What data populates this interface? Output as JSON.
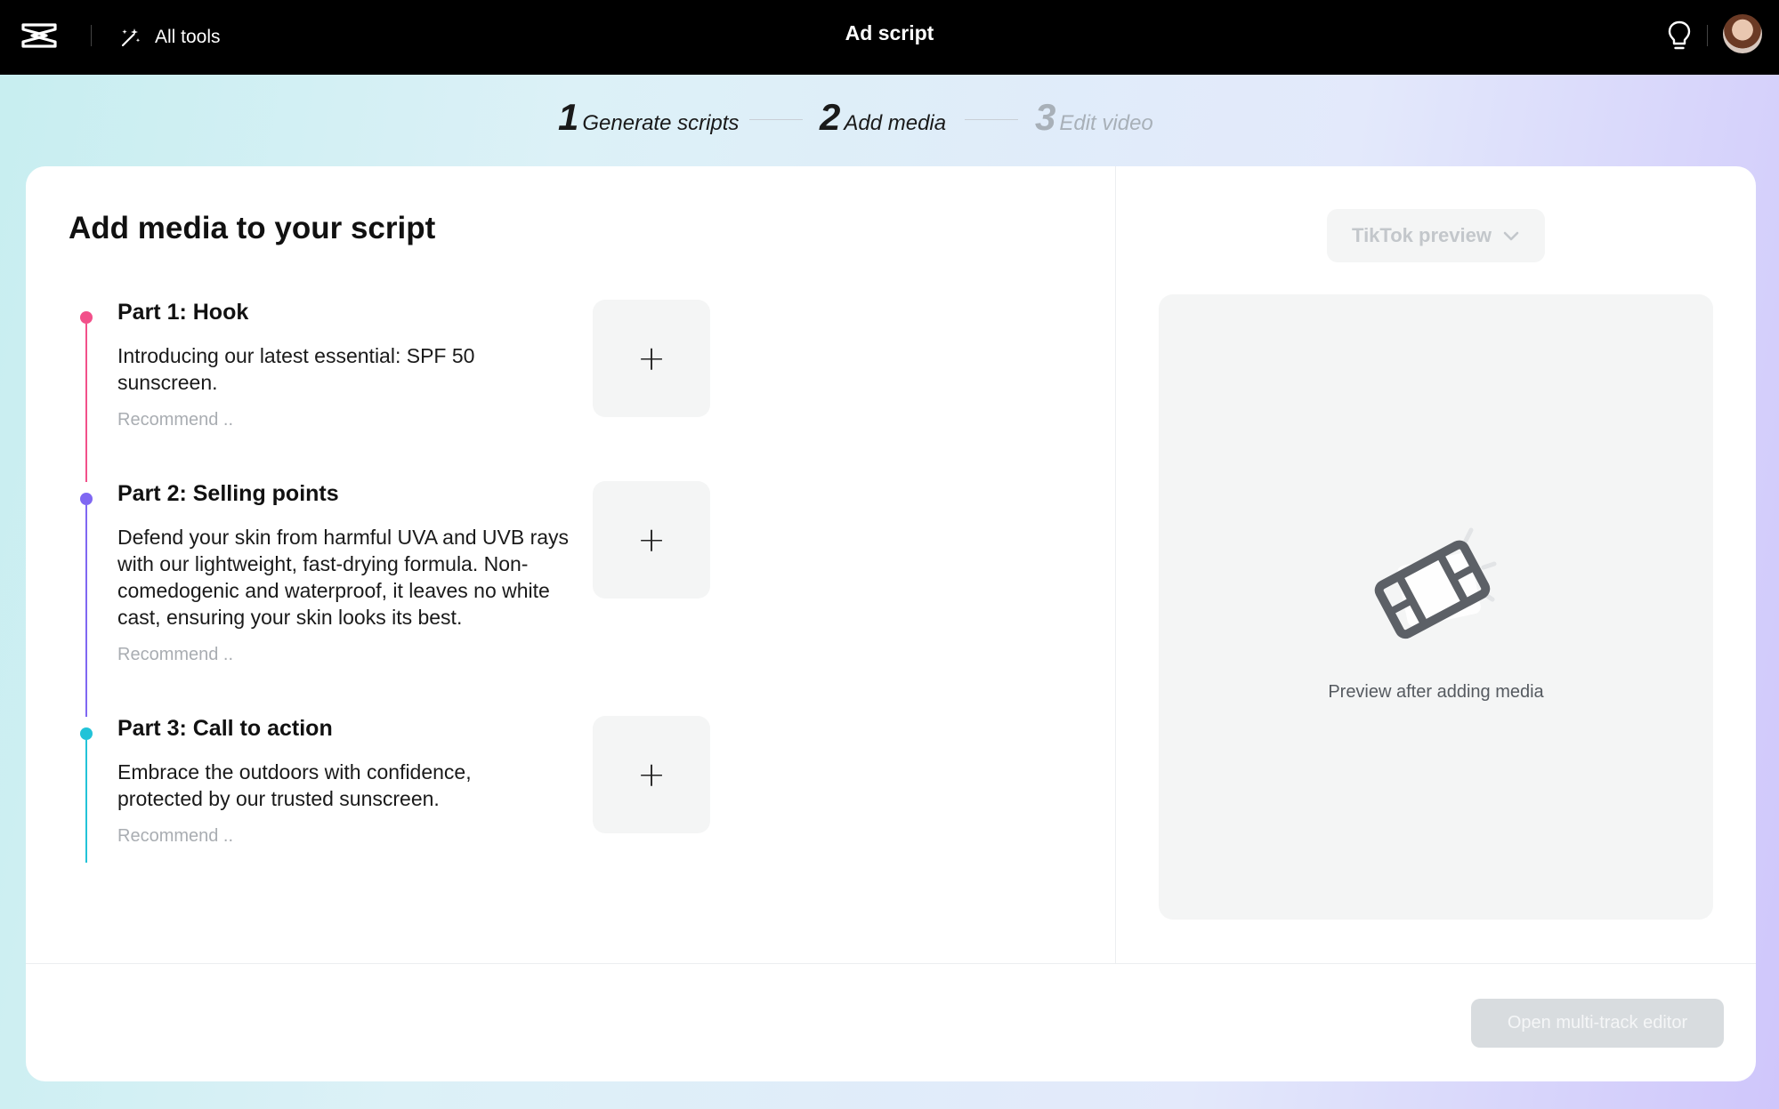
{
  "topbar": {
    "all_tools_label": "All tools",
    "title": "Ad script"
  },
  "stepper": {
    "steps": [
      {
        "num": "1",
        "label": "Generate scripts",
        "state": "done"
      },
      {
        "num": "2",
        "label": "Add media",
        "state": "active"
      },
      {
        "num": "3",
        "label": "Edit video",
        "state": "disabled"
      }
    ]
  },
  "main": {
    "title": "Add media to your script",
    "parts": [
      {
        "heading": "Part 1: Hook",
        "body": "Introducing our latest essential: SPF 50 sunscreen.",
        "recommend": "Recommend ..",
        "color": "#f2508a",
        "add_label": "+"
      },
      {
        "heading": "Part 2: Selling points",
        "body": "Defend your skin from harmful UVA and UVB rays with our lightweight, fast-drying formula. Non-comedogenic and waterproof, it leaves no white cast, ensuring your skin looks its best.",
        "recommend": "Recommend ..",
        "color": "#7f67f2",
        "add_label": "+"
      },
      {
        "heading": "Part 3: Call to action",
        "body": "Embrace the outdoors with confidence, protected by our trusted sunscreen.",
        "recommend": "Recommend ..",
        "color": "#22c3d8",
        "add_label": "+"
      }
    ]
  },
  "preview": {
    "select_label": "TikTok preview",
    "placeholder_text": "Preview after adding media"
  },
  "footer": {
    "open_editor_label": "Open multi-track editor"
  },
  "icons": {
    "logo": "capcut-logo-icon",
    "all_tools": "magic-wand-icon",
    "tips": "lightbulb-icon",
    "dropdown": "chevron-down-icon",
    "preview": "film-icon"
  }
}
